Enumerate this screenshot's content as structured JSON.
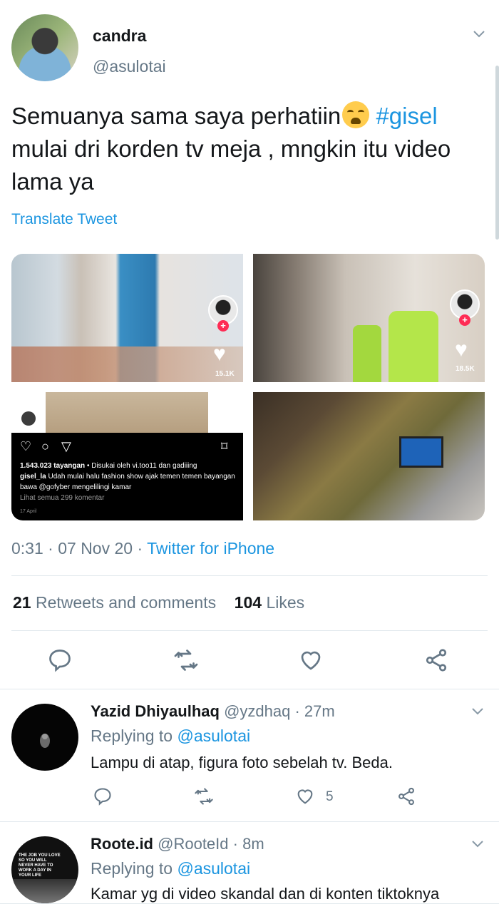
{
  "tweet": {
    "display_name": "candra",
    "handle": "@asulotai",
    "text_part1": "Semuanya sama saya perhatiin",
    "hashtag": "#gisel",
    "text_part2": "mulai dri korden tv meja , mngkin itu video lama ya",
    "translate": "Translate Tweet",
    "media": {
      "video1_likes": "15.1K",
      "video2_likes": "18.5K",
      "insta": {
        "views": "1.543.023 tayangan",
        "liked_by": "• Disukai oleh vi.too11 dan gadiiing",
        "caption_user": "gisel_la",
        "caption": "Udah mulai halu fashion show ajak temen temen bayangan bawa @gofyber mengelilingi kamar",
        "comments": "Lihat semua 299 komentar",
        "date": "17 April"
      }
    },
    "time": "0:31",
    "date": "07 Nov 20",
    "via": "Twitter for iPhone",
    "retweets_count": "21",
    "retweets_label": "Retweets and comments",
    "likes_count": "104",
    "likes_label": "Likes"
  },
  "replies": [
    {
      "name": "Yazid Dhiyaulhaq",
      "handle": "@yzdhaq",
      "time": "· 27m",
      "replying_label": "Replying to",
      "replying_to": "@asulotai",
      "text": "Lampu di atap, figura foto sebelah tv. Beda.",
      "likes": "5"
    },
    {
      "name": "Roote.id",
      "handle": "@RooteId",
      "time": "· 8m",
      "replying_label": "Replying to",
      "replying_to": "@asulotai",
      "text": "Kamar yg di video skandal dan di konten tiktoknya",
      "avatar_text": "THE JOB YOU LOVE SO YOU WILL NEVER HAVE TO WORK A DAY IN YOUR LIFE"
    }
  ],
  "colors": {
    "accent": "#1b95e0",
    "muted": "#657786",
    "text": "#14171a",
    "divider": "#e1e8ed"
  },
  "icons": [
    "chevron-down-icon",
    "reply-icon",
    "retweet-icon",
    "like-icon",
    "share-icon",
    "loudly-crying-face-emoji"
  ]
}
